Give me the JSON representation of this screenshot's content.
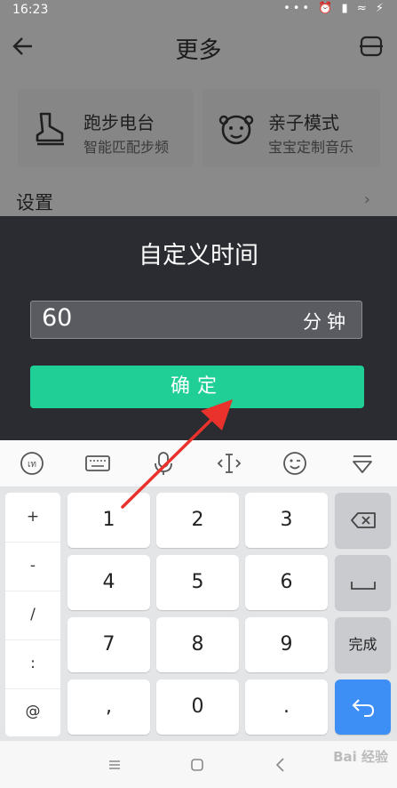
{
  "status_bar": {
    "time": "16:23",
    "icons": "••• ⏰ ▮ ≈ ⚡"
  },
  "header": {
    "title": "更多"
  },
  "cards": [
    {
      "title": "跑步电台",
      "subtitle": "智能匹配步频",
      "icon": "running-shoe-icon"
    },
    {
      "title": "亲子模式",
      "subtitle": "宝宝定制音乐",
      "icon": "baby-face-icon"
    }
  ],
  "settings": {
    "label": "设置",
    "arrow": "›"
  },
  "dialog": {
    "title": "自定义时间",
    "input_value": "60",
    "unit": "分钟",
    "confirm_label": "确定"
  },
  "keyboard": {
    "symbols": [
      "+",
      "-",
      "/",
      ":",
      "@"
    ],
    "rows": [
      [
        "1",
        "2",
        "3"
      ],
      [
        "4",
        "5",
        "6"
      ],
      [
        "7",
        "8",
        "9"
      ],
      [
        ",",
        "0",
        "."
      ]
    ],
    "done_label": "完成"
  },
  "watermark": "Bai 经验"
}
